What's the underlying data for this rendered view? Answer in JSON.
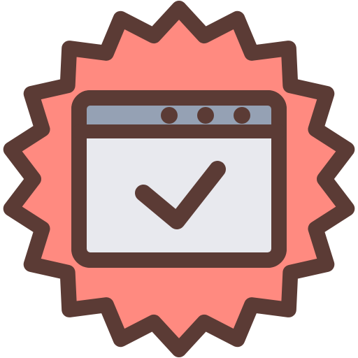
{
  "icon": {
    "name": "verified-webpage-badge-icon",
    "parts": [
      "seal-badge-icon",
      "browser-window-icon",
      "checkmark-icon"
    ]
  },
  "colors": {
    "outline": "#5b3b35",
    "seal_fill": "#ff8a80",
    "title_bar": "#95a1b4",
    "window_body": "#e8e9ee",
    "background": "#ffffff"
  },
  "window_dots": 3
}
